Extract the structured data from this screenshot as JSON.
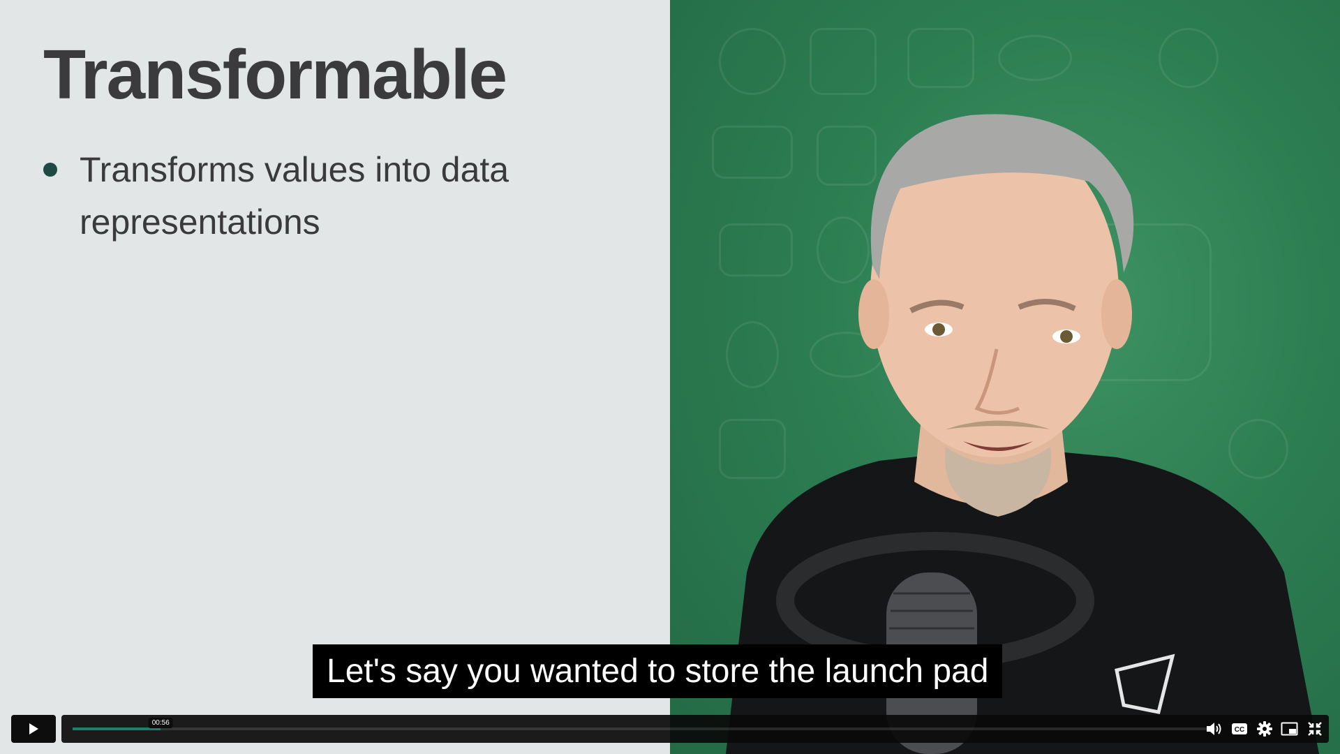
{
  "slide": {
    "title": "Transformable",
    "bullets": [
      {
        "text": "Transforms values into data representations"
      }
    ],
    "bullet_color": "#1f4a44"
  },
  "video": {
    "background_color": "#2d7d52"
  },
  "caption": {
    "text": "Let's say you wanted to store the launch pad"
  },
  "player": {
    "current_time": "00:56",
    "progress_fraction": 0.077,
    "accent_color": "#1e7f6a",
    "icons": {
      "play": "play-icon",
      "volume": "volume-icon",
      "captions": "captions-icon",
      "settings": "settings-icon",
      "pip": "picture-in-picture-icon",
      "fullscreen": "exit-fullscreen-icon"
    }
  }
}
